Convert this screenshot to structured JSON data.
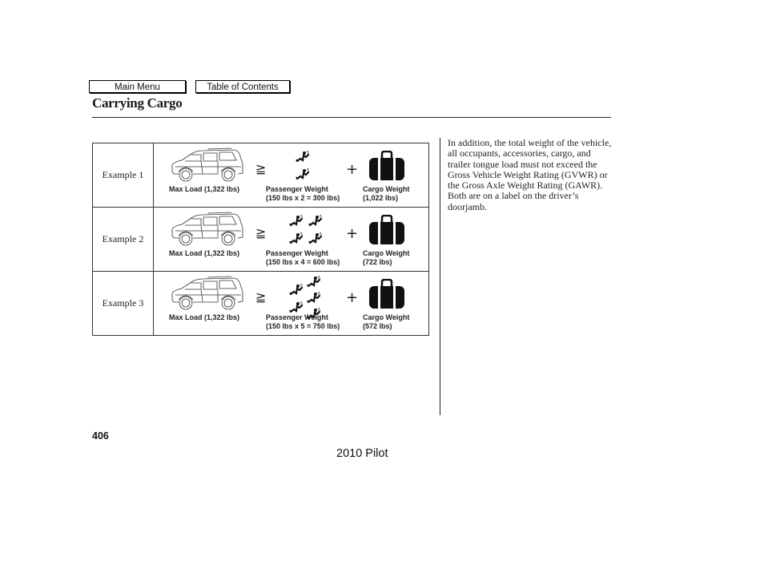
{
  "nav": {
    "main_menu": "Main Menu",
    "table_of_contents": "Table of Contents"
  },
  "page": {
    "title": "Carrying Cargo",
    "page_number": "406",
    "footer": "2010 Pilot"
  },
  "examples": [
    {
      "label": "Example 1",
      "max_load": "Max Load (1,322 lbs)",
      "operator": "≧",
      "plus": "+",
      "passenger_title": "Passenger Weight",
      "passenger_calc": "(150 lbs x 2 = 300 lbs)",
      "passenger_count": 2,
      "cargo_title": "Cargo Weight",
      "cargo_value": "(1,022 lbs)"
    },
    {
      "label": "Example 2",
      "max_load": "Max Load (1,322 lbs)",
      "operator": "≧",
      "plus": "+",
      "passenger_title": "Passenger Weight",
      "passenger_calc": "(150 lbs x 4 = 600 lbs)",
      "passenger_count": 4,
      "cargo_title": "Cargo Weight",
      "cargo_value": "(722 lbs)"
    },
    {
      "label": "Example 3",
      "max_load": "Max Load (1,322 lbs)",
      "operator": "≧",
      "plus": "+",
      "passenger_title": "Passenger Weight",
      "passenger_calc": "(150 lbs x 5 = 750 lbs)",
      "passenger_count": 5,
      "cargo_title": "Cargo Weight",
      "cargo_value": "(572 lbs)"
    }
  ],
  "sidebar_text": "In addition, the total weight of the vehicle, all occupants, accessories, cargo, and trailer tongue load must not exceed the Gross Vehicle Weight Rating (GVWR) or the Gross Axle Weight Rating (GAWR). Both are on a label on the driver’s doorjamb.",
  "icons": {
    "vehicle": "suv-side-view-icon",
    "passenger": "seated-passenger-icon",
    "cargo": "suitcase-icon"
  }
}
